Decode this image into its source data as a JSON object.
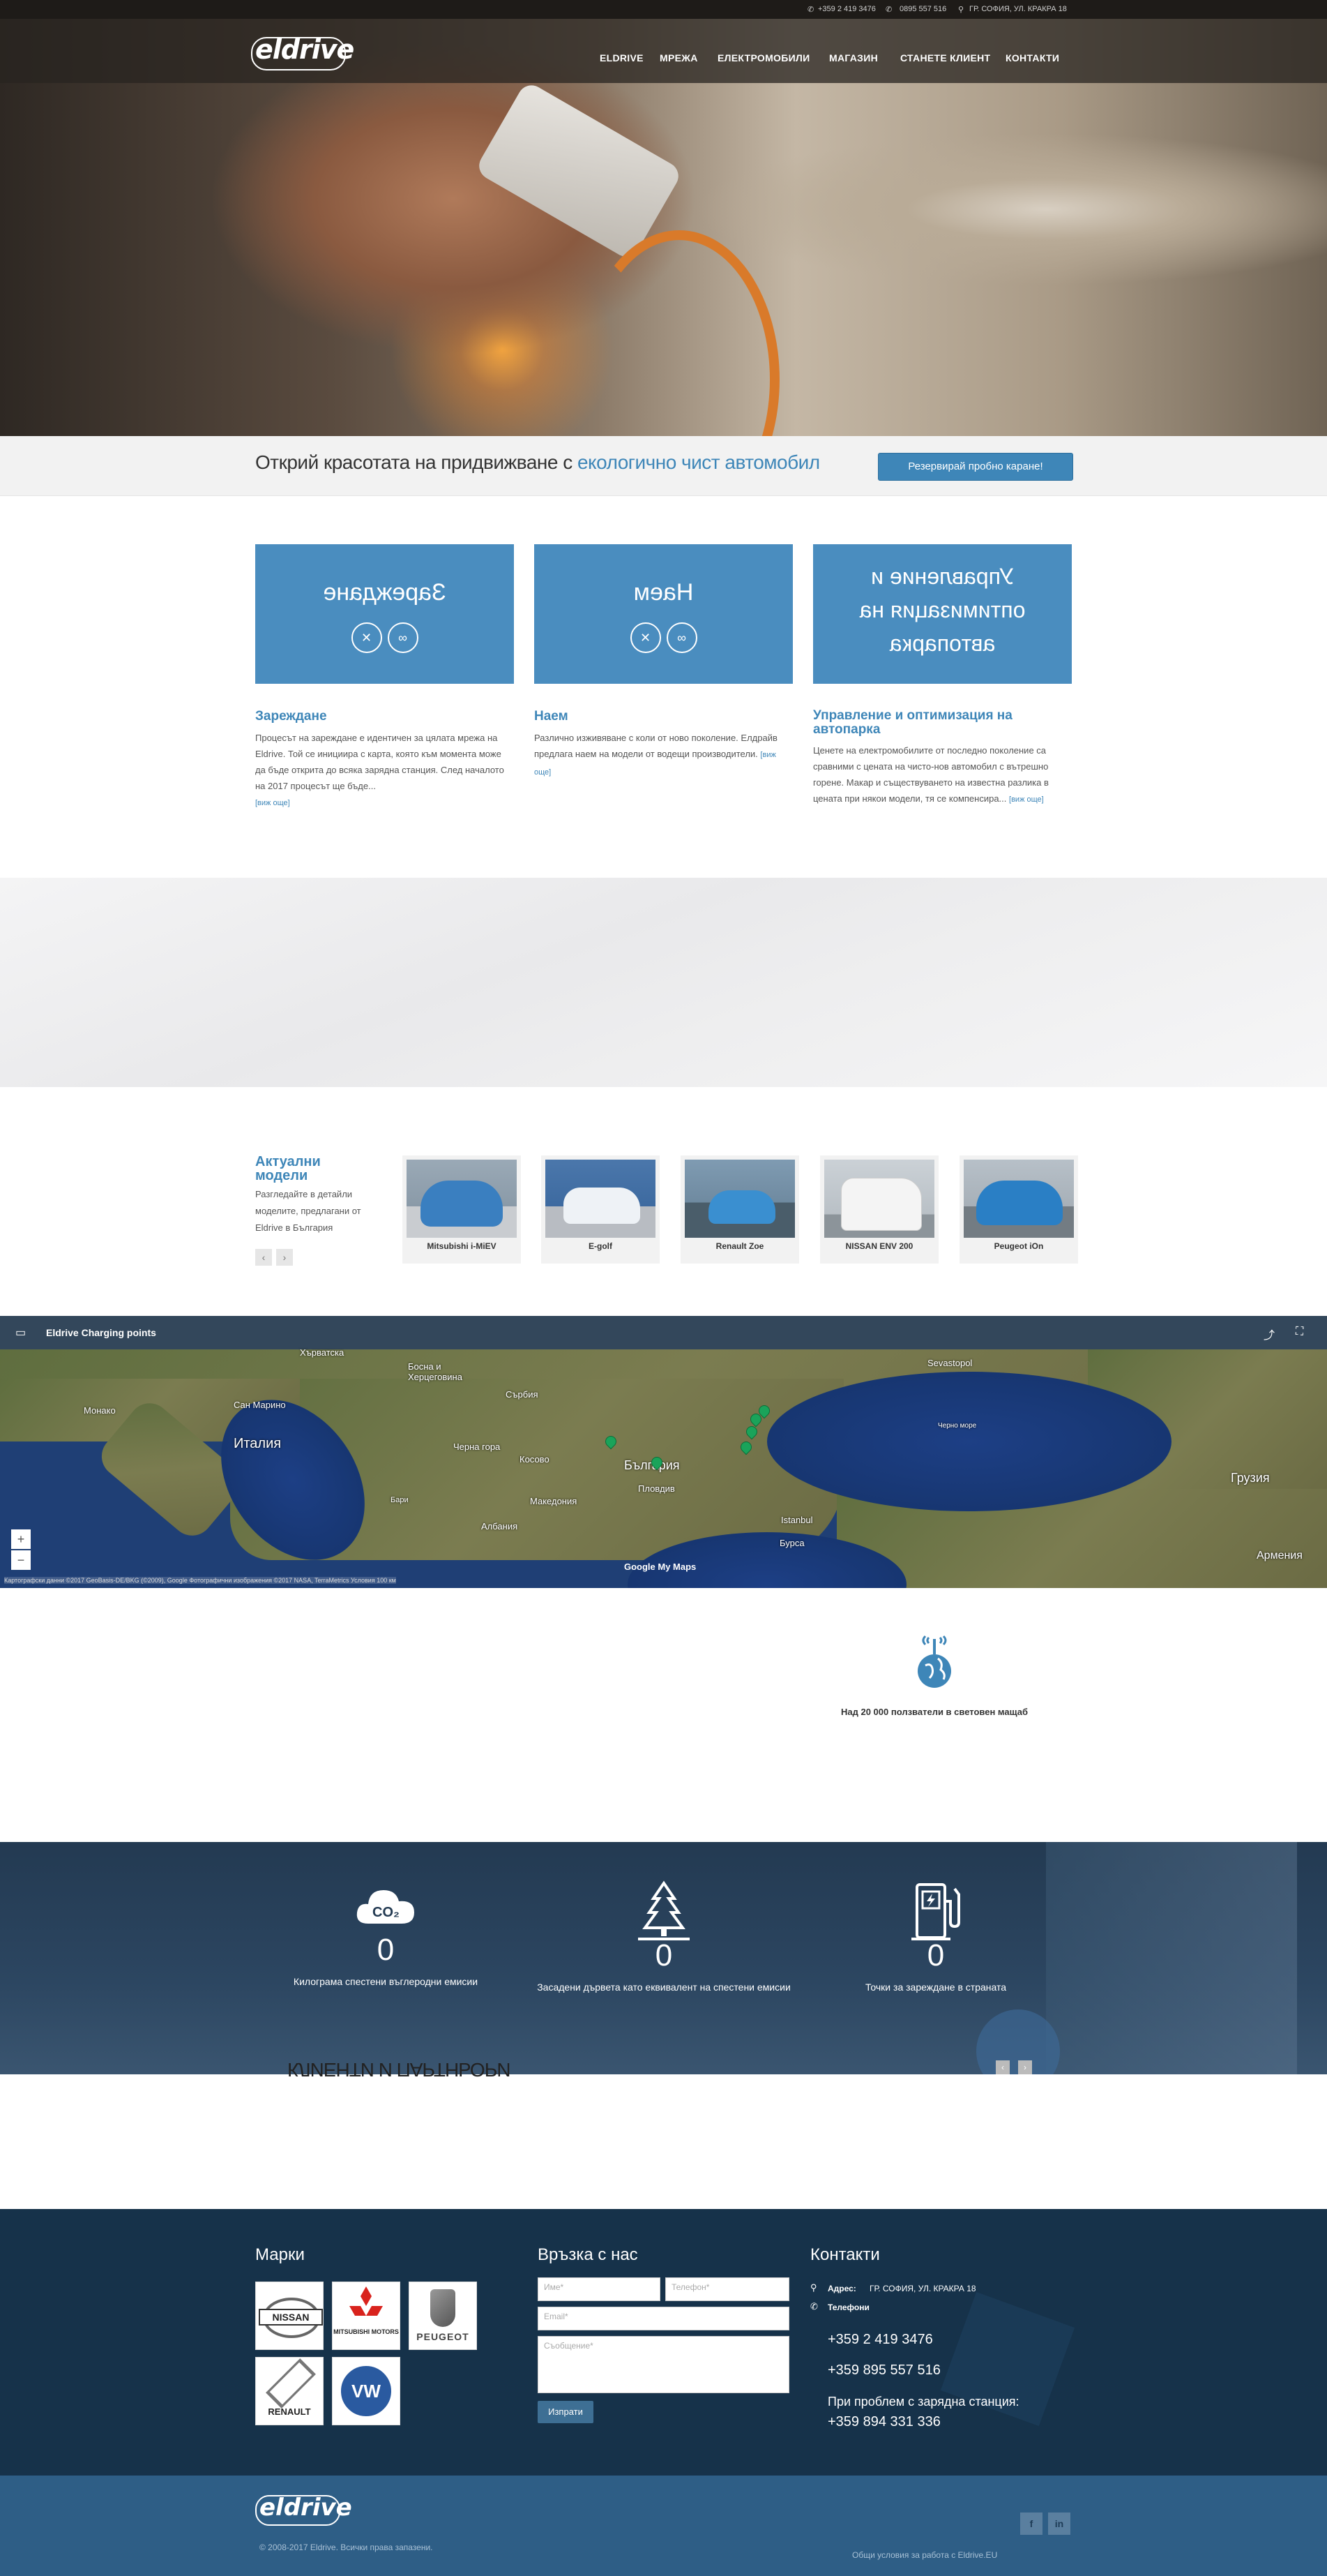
{
  "topbar": {
    "phone1": "+359 2 419 3476",
    "phone2": "0895 557 516",
    "address": "ГР. СОФИЯ, УЛ. КРАКРА 18"
  },
  "header": {
    "logo": "eldrive",
    "nav": [
      "ELDRIVE",
      "МРЕЖА",
      "ЕЛЕКТРОМОБИЛИ",
      "МАГАЗИН",
      "СТАНЕТЕ КЛИЕНТ",
      "КОНТАКТИ"
    ]
  },
  "band": {
    "slogan_main": "Открий красотата на придвижване с ",
    "slogan_highlight": "екологично чист автомобил",
    "button": "Резервирай пробно каране!"
  },
  "services": [
    {
      "box_title": "Зареждане",
      "title": "Зареждане",
      "text": "Процесът на зареждане е идентичен за цялата мрежа на Eldrive. Той се инициира с карта, която към момента може да бъде открита до всяка зарядна станция. След началото на 2017 процесът ще бъде...",
      "more": "[виж още]"
    },
    {
      "box_title": "Наем",
      "title": "Наем",
      "text": "Различно изживяване с коли от ново поколение. Елдрайв предлага наем на модели от водещи производители.",
      "more": "[виж още]"
    },
    {
      "box_title": "Управление и оптимизация на автопарка",
      "title": "Управление и оптимизация на автопарка",
      "text": "Ценете на електромобилите от последно поколение са сравними с цената на чисто-нов автомобил с вътрешно горене. Макар и съществуването на известна разлика в цената при някои модели, тя се компенсира...",
      "more": "[виж още]"
    }
  ],
  "models": {
    "title": "Актуални модели",
    "desc": "Разгледайте в детайли моделите, предлагани от Eldrive в България",
    "prev": "‹",
    "next": "›",
    "items": [
      {
        "name": "Mitsubishi i-MiEV",
        "color": "#3a7fc0",
        "bg": "#8a9aa8"
      },
      {
        "name": "E-golf",
        "color": "#2d6fc0",
        "bg": "#3d6aa0"
      },
      {
        "name": "Renault Zoe",
        "color": "#3a8fd0",
        "bg": "#6f8aa0"
      },
      {
        "name": "NISSAN ENV 200",
        "color": "#f4f4f4",
        "bg": "#b9c0c6"
      },
      {
        "name": "Peugeot iOn",
        "color": "#2a7fc5",
        "bg": "#a7b0b8"
      }
    ]
  },
  "map": {
    "title": "Eldrive Charging points",
    "labels": [
      {
        "text": "Хърватска"
      },
      {
        "text": "Босна и Херцеговина"
      },
      {
        "text": "Сърбия"
      },
      {
        "text": "Сан Марино"
      },
      {
        "text": "Монако"
      },
      {
        "text": "Италия"
      },
      {
        "text": "Черна гора"
      },
      {
        "text": "Косово"
      },
      {
        "text": "Македония"
      },
      {
        "text": "Албания"
      },
      {
        "text": "България"
      },
      {
        "text": "Пловдив"
      },
      {
        "text": "Черно море"
      },
      {
        "text": "Sevastopol"
      },
      {
        "text": "Istanbul"
      },
      {
        "text": "Бурса"
      },
      {
        "text": "Грузия"
      },
      {
        "text": "Армения"
      },
      {
        "text": "Бари"
      }
    ],
    "attribution": "Картографски данни ©2017 GeoBasis-DE/BKG (©2009), Google Фотографични изображения ©2017 NASA, TerraMetrics   Условия   100 км",
    "google": "Google My Maps",
    "zoom_in": "+",
    "zoom_out": "−"
  },
  "users": {
    "text": "Над 20 000 ползватели в световен мащаб"
  },
  "counters": [
    {
      "icon": "co2-cloud-icon",
      "value": "0",
      "label": "Килограма спестени въглеродни емисии"
    },
    {
      "icon": "tree-icon",
      "value": "0",
      "label": "Засадени дървета като еквивалент на спестени емисии"
    },
    {
      "icon": "charging-station-icon",
      "value": "0",
      "label": "Точки за зареждане в страната"
    }
  ],
  "partners_title": "КЛИЕНТИ И ПАРТНЬОРИ",
  "footer": {
    "brands_title": "Марки",
    "brands": [
      "NISSAN",
      "MITSUBISHI MOTORS",
      "PEUGEOT",
      "RENAULT",
      "VW"
    ],
    "contact_title": "Връзка с нас",
    "name_ph": "Име*",
    "phone_ph": "Телефон*",
    "email_ph": "Email*",
    "message_ph": "Съобщение*",
    "send": "Изпрати",
    "contacts_title": "Контакти",
    "address_label": "Адрес:",
    "address": "ГР. СОФИЯ, УЛ. КРАКРА 18",
    "phones_label": "Телефони",
    "phone1": "+359 2 419 3476",
    "phone2": "+359 895 557 516",
    "problem": "При проблем с зарядна станция:",
    "phone3": "+359 894 331 336"
  },
  "bottom": {
    "logo": "eldrive",
    "copyright": "© 2008-2017 Eldrive. Всички права запазени.",
    "terms": "Общи условия за работа с Eldrive.EU",
    "facebook": "f",
    "linkedin": "in"
  },
  "colors": {
    "accent": "#3e86b8",
    "footer": "#16324a",
    "copybar": "#2e5e86"
  }
}
